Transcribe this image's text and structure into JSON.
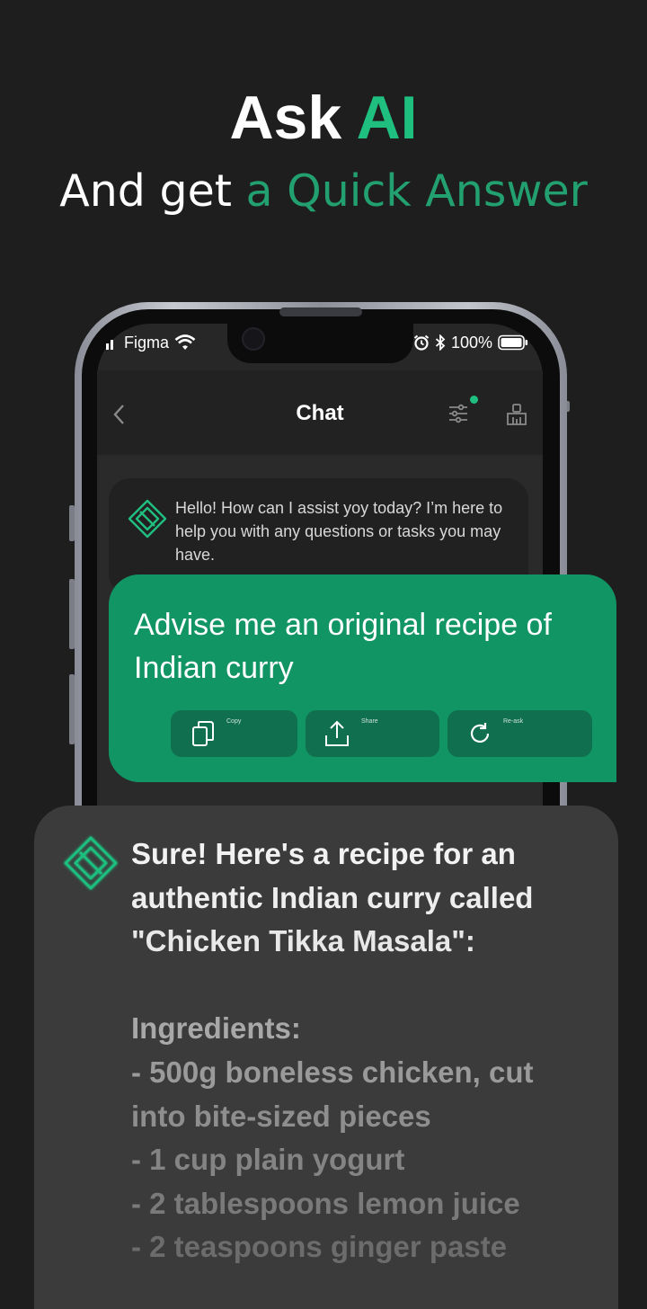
{
  "headline": {
    "prefix": "Ask ",
    "accent": "AI"
  },
  "subline": {
    "prefix": "And get ",
    "accent": "a Quick Answer"
  },
  "status_bar": {
    "carrier": "Figma",
    "battery": "100%"
  },
  "chat_header": {
    "title": "Chat",
    "back_icon": "chevron-left-icon",
    "settings_icon": "sliders-icon",
    "clean_icon": "broom-icon",
    "accent": "#1fbf7f"
  },
  "greeting": {
    "text": "Hello! How can  I assist yoy today? I’m here to help you with any questions or tasks you may have."
  },
  "user_message": {
    "text": "Advise me an original recipe of Indian curry",
    "actions": [
      {
        "label": "Copy",
        "icon": "copy-icon"
      },
      {
        "label": "Share",
        "icon": "share-icon"
      },
      {
        "label": "Re-ask",
        "icon": "refresh-icon"
      }
    ]
  },
  "ai_response": {
    "lines": [
      "Sure! Here's a recipe for an",
      "authentic Indian curry called",
      "\"Chicken Tikka Masala\":",
      "",
      "Ingredients:",
      "- 500g boneless chicken, cut",
      "into bite-sized pieces",
      "- 1 cup plain yogurt",
      "- 2 tablespoons lemon juice",
      "- 2 teaspoons ginger paste"
    ]
  },
  "colors": {
    "background": "#1e1e1e",
    "brand": "#1fbf7f",
    "user_bubble": "#129565"
  }
}
